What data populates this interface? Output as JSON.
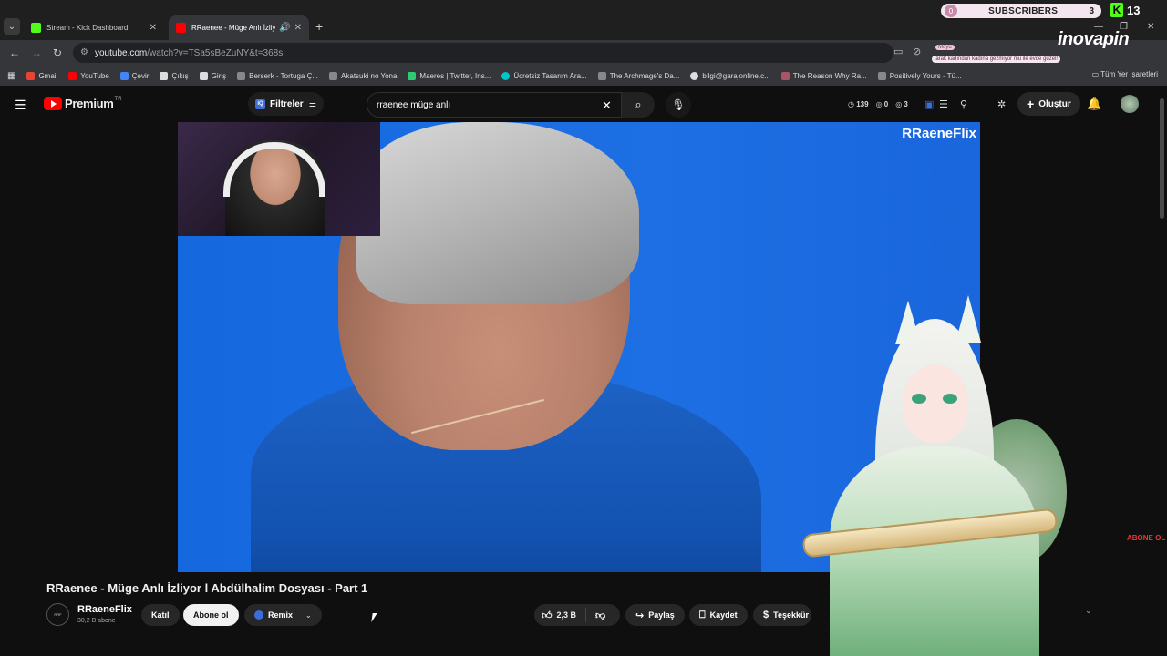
{
  "browser": {
    "tabs": [
      {
        "title": "Stream - Kick Dashboard",
        "favicon_color": "#53fc18",
        "active": false
      },
      {
        "title": "RRaenee - Müge Anlı İzliyor",
        "favicon_color": "#ff0000",
        "active": true
      }
    ],
    "url_host": "youtube.com",
    "url_rest": "/watch?v=TSa5sBeZuNY&t=368s",
    "bookmarks": [
      {
        "label": "Gmail",
        "color": "#ea4335"
      },
      {
        "label": "YouTube",
        "color": "#ff0000"
      },
      {
        "label": "Çevir",
        "color": "#4285f4"
      },
      {
        "label": "Çıkış",
        "color": "#ddd"
      },
      {
        "label": "Giriş",
        "color": "#ddd"
      },
      {
        "label": "Berserk - Tortuga Ç...",
        "color": "#888"
      },
      {
        "label": "Akatsuki no Yona",
        "color": "#888"
      },
      {
        "label": "Maeres | Twitter, Ins...",
        "color": "#2ecc71"
      },
      {
        "label": "Ücretsiz Tasarım Ara...",
        "color": "#00c4cc"
      },
      {
        "label": "The Archmage's Da...",
        "color": "#888"
      },
      {
        "label": "bilgi@garajonline.c...",
        "color": "#ddd"
      },
      {
        "label": "The Reason Why Ra...",
        "color": "#a56"
      },
      {
        "label": "Positively Yours - Tü...",
        "color": "#888"
      }
    ],
    "all_bookmarks_label": "Tüm Yer İşaretleri"
  },
  "stream_overlay": {
    "subs_label": "SUBSCRIBERS",
    "subs_start": "0",
    "subs_count": "3",
    "kick_count": "13",
    "inovapin_label": "inovapin",
    "moyu_label": "Moyu",
    "overlay_note": "larak kadından kadına gezmiyor mu ile evde güzel!"
  },
  "youtube": {
    "logo_word": "Premium",
    "logo_region": "TR",
    "filters_label": "Filtreler",
    "search_query": "rraenee müge anlı",
    "stats": {
      "views": "139",
      "eye": "0",
      "third": "3"
    },
    "create_label": "Oluştur"
  },
  "video": {
    "watermark": "RRaeneFlix",
    "title": "RRaenee - Müge Anlı İzliyor l Abdülhalim Dosyası - Part 1",
    "channel_name": "RRaeneFlix",
    "channel_subs": "30,2 B abone",
    "join_label": "Katıl",
    "subscribe_label": "Abone ol",
    "remix_label": "Remix",
    "likes": "2,3 B",
    "share_label": "Paylaş",
    "save_label": "Kaydet",
    "thanks_label": "Teşekkür",
    "abone_sticker": "ABONE OL"
  }
}
